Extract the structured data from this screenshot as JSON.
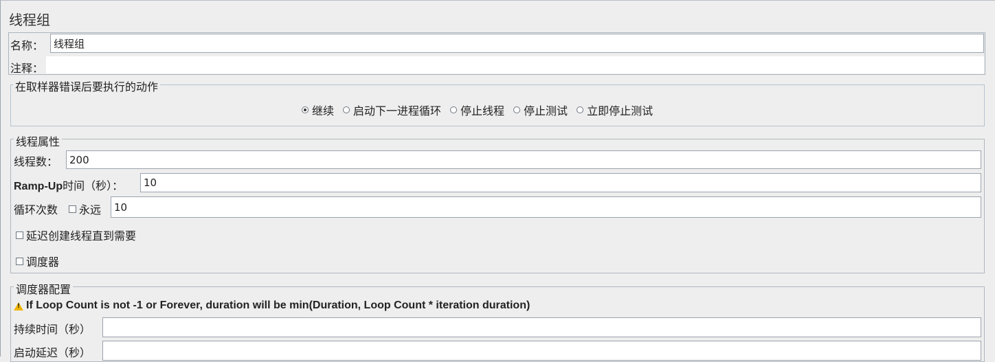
{
  "page_title": "线程组",
  "name_field": {
    "label": "名称：",
    "value": "线程组"
  },
  "comment_field": {
    "label": "注释：",
    "value": ""
  },
  "sampler_error": {
    "legend": "在取样器错误后要执行的动作",
    "options": [
      "继续",
      "启动下一进程循环",
      "停止线程",
      "停止测试",
      "立即停止测试"
    ],
    "selected": "继续"
  },
  "thread_props": {
    "legend": "线程属性",
    "threads_label": "线程数：",
    "threads_value": "200",
    "rampup_label_bold": "Ramp-Up",
    "rampup_label_rest": "时间（秒）：",
    "rampup_value": "10",
    "loop_label": "循环次数",
    "forever_label": "永远",
    "loop_value": "10",
    "delay_label": "延迟创建线程直到需要",
    "scheduler_label": "调度器"
  },
  "scheduler_config": {
    "legend": "调度器配置",
    "warning": "If Loop Count is not -1 or Forever, duration will be min(Duration, Loop Count * iteration duration)",
    "duration_label": "持续时间（秒）",
    "duration_value": "",
    "startup_label": "启动延迟（秒）",
    "startup_value": ""
  }
}
